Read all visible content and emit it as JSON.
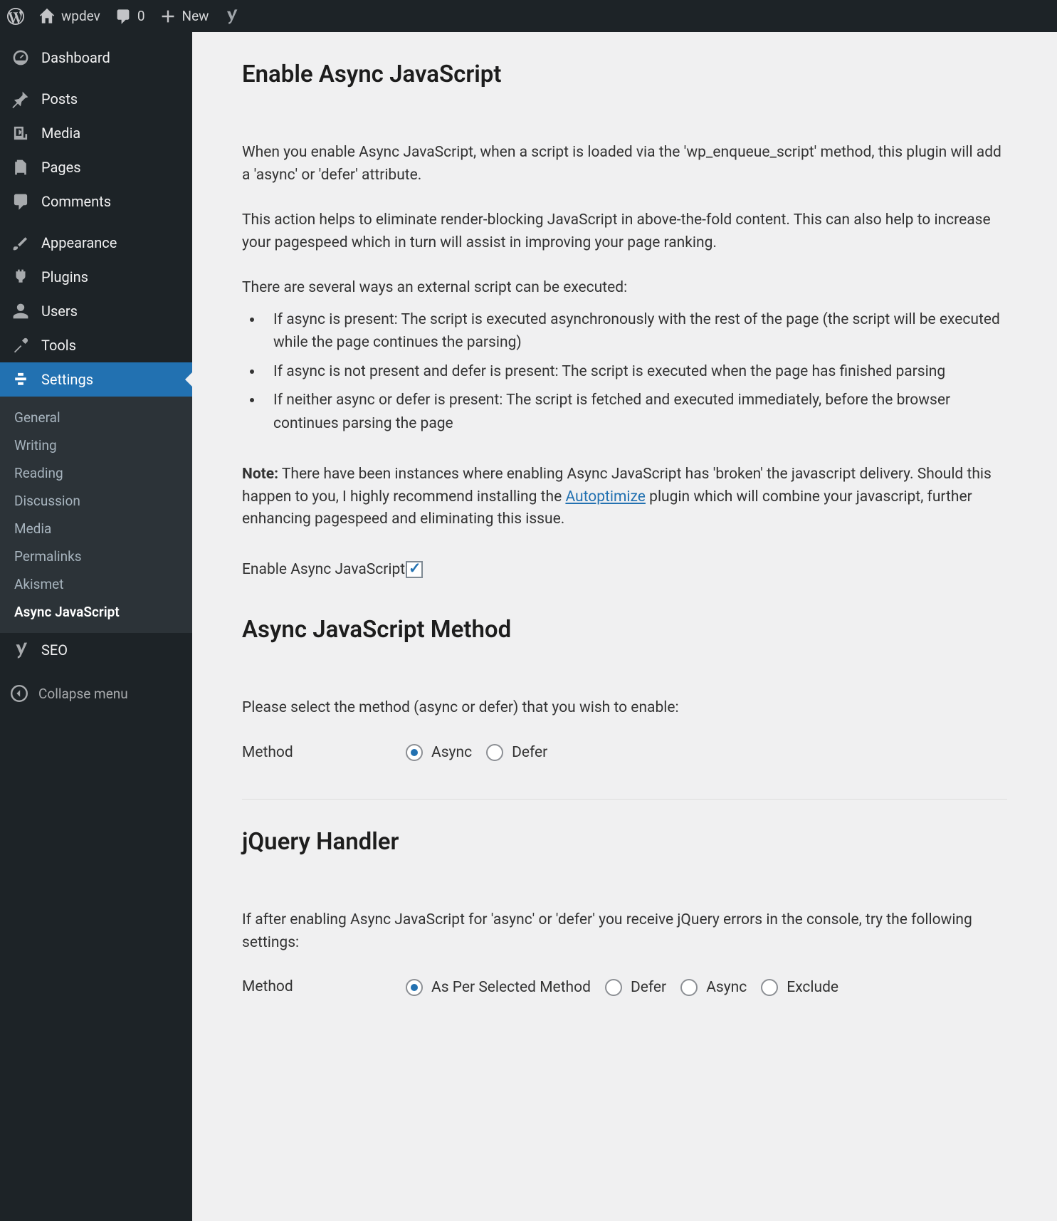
{
  "adminbar": {
    "site_name": "wpdev",
    "comments_count": "0",
    "new_label": "New"
  },
  "menu": {
    "dashboard": "Dashboard",
    "posts": "Posts",
    "media": "Media",
    "pages": "Pages",
    "comments": "Comments",
    "appearance": "Appearance",
    "plugins": "Plugins",
    "users": "Users",
    "tools": "Tools",
    "settings": "Settings",
    "seo": "SEO",
    "collapse": "Collapse menu"
  },
  "submenu": {
    "general": "General",
    "writing": "Writing",
    "reading": "Reading",
    "discussion": "Discussion",
    "media": "Media",
    "permalinks": "Permalinks",
    "akismet": "Akismet",
    "asyncjs": "Async JavaScript"
  },
  "section1": {
    "heading": "Enable Async JavaScript",
    "p1": "When you enable Async JavaScript, when a script is loaded via the 'wp_enqueue_script' method, this plugin will add a 'async' or 'defer' attribute.",
    "p2": "This action helps to eliminate render-blocking JavaScript in above-the-fold content. This can also help to increase your pagespeed which in turn will assist in improving your page ranking.",
    "p3": "There are several ways an external script can be executed:",
    "li1": "If async is present: The script is executed asynchronously with the rest of the page (the script will be executed while the page continues the parsing)",
    "li2": "If async is not present and defer is present: The script is executed when the page has finished parsing",
    "li3": "If neither async or defer is present: The script is fetched and executed immediately, before the browser continues parsing the page",
    "note_label": "Note:",
    "note_text_a": " There have been instances where enabling Async JavaScript has 'broken' the javascript delivery. Should this happen to you, I highly recommend installing the ",
    "note_link": "Autoptimize",
    "note_text_b": " plugin which will combine your javascript, further enhancing pagespeed and eliminating this issue.",
    "field_label": "Enable Async JavaScript"
  },
  "section2": {
    "heading": "Async JavaScript Method",
    "p1": "Please select the method (async or defer) that you wish to enable:",
    "field_label": "Method",
    "opt_async": "Async",
    "opt_defer": "Defer"
  },
  "section3": {
    "heading": "jQuery Handler",
    "p1": "If after enabling Async JavaScript for 'async' or 'defer' you receive jQuery errors in the console, try the following settings:",
    "field_label": "Method",
    "opt1": "As Per Selected Method",
    "opt2": "Defer",
    "opt3": "Async",
    "opt4": "Exclude"
  }
}
